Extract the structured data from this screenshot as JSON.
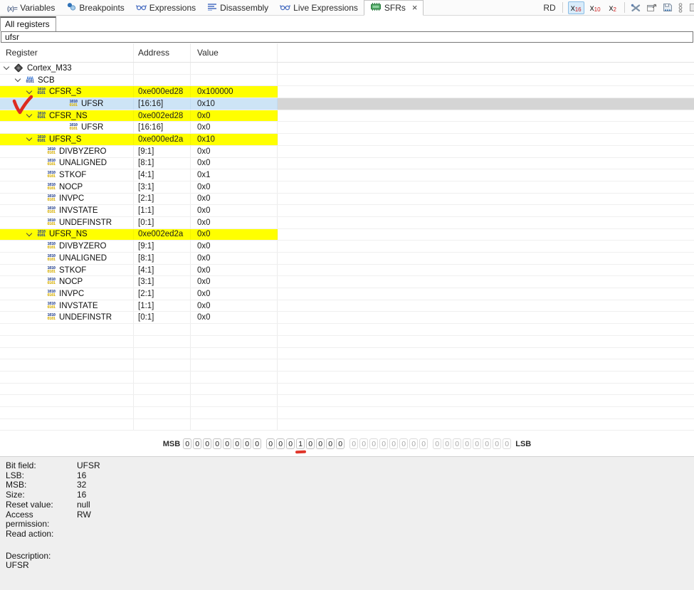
{
  "toolbar": {
    "tabs": [
      {
        "label": "Variables",
        "icon": "variables-icon",
        "active": false
      },
      {
        "label": "Breakpoints",
        "icon": "breakpoints-icon",
        "active": false
      },
      {
        "label": "Expressions",
        "icon": "expressions-icon",
        "active": false
      },
      {
        "label": "Disassembly",
        "icon": "disassembly-icon",
        "active": false
      },
      {
        "label": "Live Expressions",
        "icon": "live-expressions-icon",
        "active": false
      },
      {
        "label": "SFRs",
        "icon": "sfrs-icon",
        "active": true,
        "closable": true
      }
    ],
    "close_glyph": "×",
    "rd_label": "RD",
    "radix_buttons": [
      {
        "base": "x",
        "sub": "16",
        "selected": true
      },
      {
        "base": "x",
        "sub": "10",
        "selected": false
      },
      {
        "base": "x",
        "sub": "2",
        "selected": false
      }
    ],
    "action_icons": [
      "tools-icon",
      "export-icon",
      "save-icon",
      "kebab-menu-icon"
    ]
  },
  "subtab_label": "All registers",
  "search": {
    "value": "ufsr"
  },
  "table": {
    "columns": [
      "Register",
      "Address",
      "Value"
    ],
    "rows": [
      {
        "name": "Cortex_M33",
        "address": "",
        "value": "",
        "indent": 6,
        "chevron": true,
        "icon": "chip",
        "bg": "none"
      },
      {
        "name": "SCB",
        "address": "",
        "value": "",
        "indent": 22,
        "chevron": true,
        "icon": "periph",
        "bg": "none"
      },
      {
        "name": "CFSR_S",
        "address": "0xe000ed28",
        "value": "0x100000",
        "indent": 38,
        "chevron": true,
        "icon": "register",
        "bg": "yellow"
      },
      {
        "name": "UFSR",
        "address": "[16:16]",
        "value": "0x10",
        "indent": 96,
        "chevron": false,
        "icon": "field",
        "bg": "selected",
        "annotation": "red-check"
      },
      {
        "name": "CFSR_NS",
        "address": "0xe002ed28",
        "value": "0x0",
        "indent": 38,
        "chevron": true,
        "icon": "register",
        "bg": "yellow"
      },
      {
        "name": "UFSR",
        "address": "[16:16]",
        "value": "0x0",
        "indent": 96,
        "chevron": false,
        "icon": "field",
        "bg": "none"
      },
      {
        "name": "UFSR_S",
        "address": "0xe000ed2a",
        "value": "0x10",
        "indent": 38,
        "chevron": true,
        "icon": "register",
        "bg": "yellow"
      },
      {
        "name": "DIVBYZERO",
        "address": "[9:1]",
        "value": "0x0",
        "indent": 65,
        "chevron": false,
        "icon": "field",
        "bg": "none"
      },
      {
        "name": "UNALIGNED",
        "address": "[8:1]",
        "value": "0x0",
        "indent": 65,
        "chevron": false,
        "icon": "field",
        "bg": "none"
      },
      {
        "name": "STKOF",
        "address": "[4:1]",
        "value": "0x1",
        "indent": 65,
        "chevron": false,
        "icon": "field",
        "bg": "none"
      },
      {
        "name": "NOCP",
        "address": "[3:1]",
        "value": "0x0",
        "indent": 65,
        "chevron": false,
        "icon": "field",
        "bg": "none"
      },
      {
        "name": "INVPC",
        "address": "[2:1]",
        "value": "0x0",
        "indent": 65,
        "chevron": false,
        "icon": "field",
        "bg": "none"
      },
      {
        "name": "INVSTATE",
        "address": "[1:1]",
        "value": "0x0",
        "indent": 65,
        "chevron": false,
        "icon": "field",
        "bg": "none"
      },
      {
        "name": "UNDEFINSTR",
        "address": "[0:1]",
        "value": "0x0",
        "indent": 65,
        "chevron": false,
        "icon": "field",
        "bg": "none"
      },
      {
        "name": "UFSR_NS",
        "address": "0xe002ed2a",
        "value": "0x0",
        "indent": 38,
        "chevron": true,
        "icon": "register",
        "bg": "yellow"
      },
      {
        "name": "DIVBYZERO",
        "address": "[9:1]",
        "value": "0x0",
        "indent": 65,
        "chevron": false,
        "icon": "field",
        "bg": "none"
      },
      {
        "name": "UNALIGNED",
        "address": "[8:1]",
        "value": "0x0",
        "indent": 65,
        "chevron": false,
        "icon": "field",
        "bg": "none"
      },
      {
        "name": "STKOF",
        "address": "[4:1]",
        "value": "0x0",
        "indent": 65,
        "chevron": false,
        "icon": "field",
        "bg": "none"
      },
      {
        "name": "NOCP",
        "address": "[3:1]",
        "value": "0x0",
        "indent": 65,
        "chevron": false,
        "icon": "field",
        "bg": "none"
      },
      {
        "name": "INVPC",
        "address": "[2:1]",
        "value": "0x0",
        "indent": 65,
        "chevron": false,
        "icon": "field",
        "bg": "none"
      },
      {
        "name": "INVSTATE",
        "address": "[1:1]",
        "value": "0x0",
        "indent": 65,
        "chevron": false,
        "icon": "field",
        "bg": "none"
      },
      {
        "name": "UNDEFINSTR",
        "address": "[0:1]",
        "value": "0x0",
        "indent": 65,
        "chevron": false,
        "icon": "field",
        "bg": "none"
      }
    ],
    "empty_row_count": 9
  },
  "bit_strip": {
    "msb_label": "MSB",
    "lsb_label": "LSB",
    "bits": "00000000000100000000000000000000",
    "active_bit_count": 16,
    "annotated_bit_index": 11,
    "group_size": 8
  },
  "details": {
    "fields": [
      {
        "label": "Bit field:",
        "value": "UFSR"
      },
      {
        "label": "LSB:",
        "value": "16"
      },
      {
        "label": "MSB:",
        "value": "32"
      },
      {
        "label": "Size:",
        "value": "16"
      },
      {
        "label": "Reset value:",
        "value": "null"
      },
      {
        "label": "Access permission:",
        "value": "RW"
      },
      {
        "label": "Read action:",
        "value": ""
      }
    ],
    "description_label": "Description:",
    "description_value": "UFSR"
  },
  "colors": {
    "row_highlight_yellow": "#ffff00",
    "row_selected_blue": "#cde4f6",
    "row_selected_gray": "#d5d5d5",
    "annotation_red": "#e0362b",
    "radix_subscript_red": "#cc2020",
    "radix_selected_bg": "#d9ecfa"
  }
}
